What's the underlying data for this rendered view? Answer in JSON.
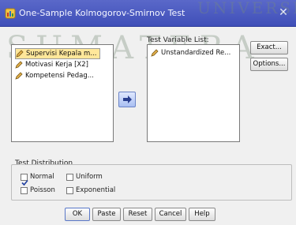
{
  "window": {
    "title": "One-Sample Kolmogorov-Smirnov Test",
    "close_symbol": "✕"
  },
  "source_list": {
    "items": [
      {
        "label": "Supervisi Kepala m...",
        "selected": true
      },
      {
        "label": "Motivasi Kerja [X2]",
        "selected": false
      },
      {
        "label": "Kompetensi Pedag...",
        "selected": false
      }
    ]
  },
  "test_variable_list": {
    "label": "Test Variable List:",
    "items": [
      {
        "label": "Unstandardized Re..."
      }
    ]
  },
  "side_buttons": {
    "exact": "Exact...",
    "options": "Options..."
  },
  "test_distribution": {
    "label": "Test Distribution",
    "options": [
      {
        "label": "Normal",
        "checked": true
      },
      {
        "label": "Uniform",
        "checked": false
      },
      {
        "label": "Poisson",
        "checked": false
      },
      {
        "label": "Exponential",
        "checked": false
      }
    ]
  },
  "footer_buttons": {
    "ok": "OK",
    "paste": "Paste",
    "reset": "Reset",
    "cancel": "Cancel",
    "help": "Help"
  },
  "watermark": [
    "UNIVERSIT",
    "SUMATERA"
  ],
  "colors": {
    "titlebar": "#4656bf",
    "selected_item": "#ffe79a",
    "dialog_bg": "#f0f0f0",
    "check": "#1f3fa0"
  },
  "icons": {
    "app": "spss-dialog-icon",
    "variable": "scale-variable-pencil-icon",
    "move": "right-arrow-icon"
  }
}
